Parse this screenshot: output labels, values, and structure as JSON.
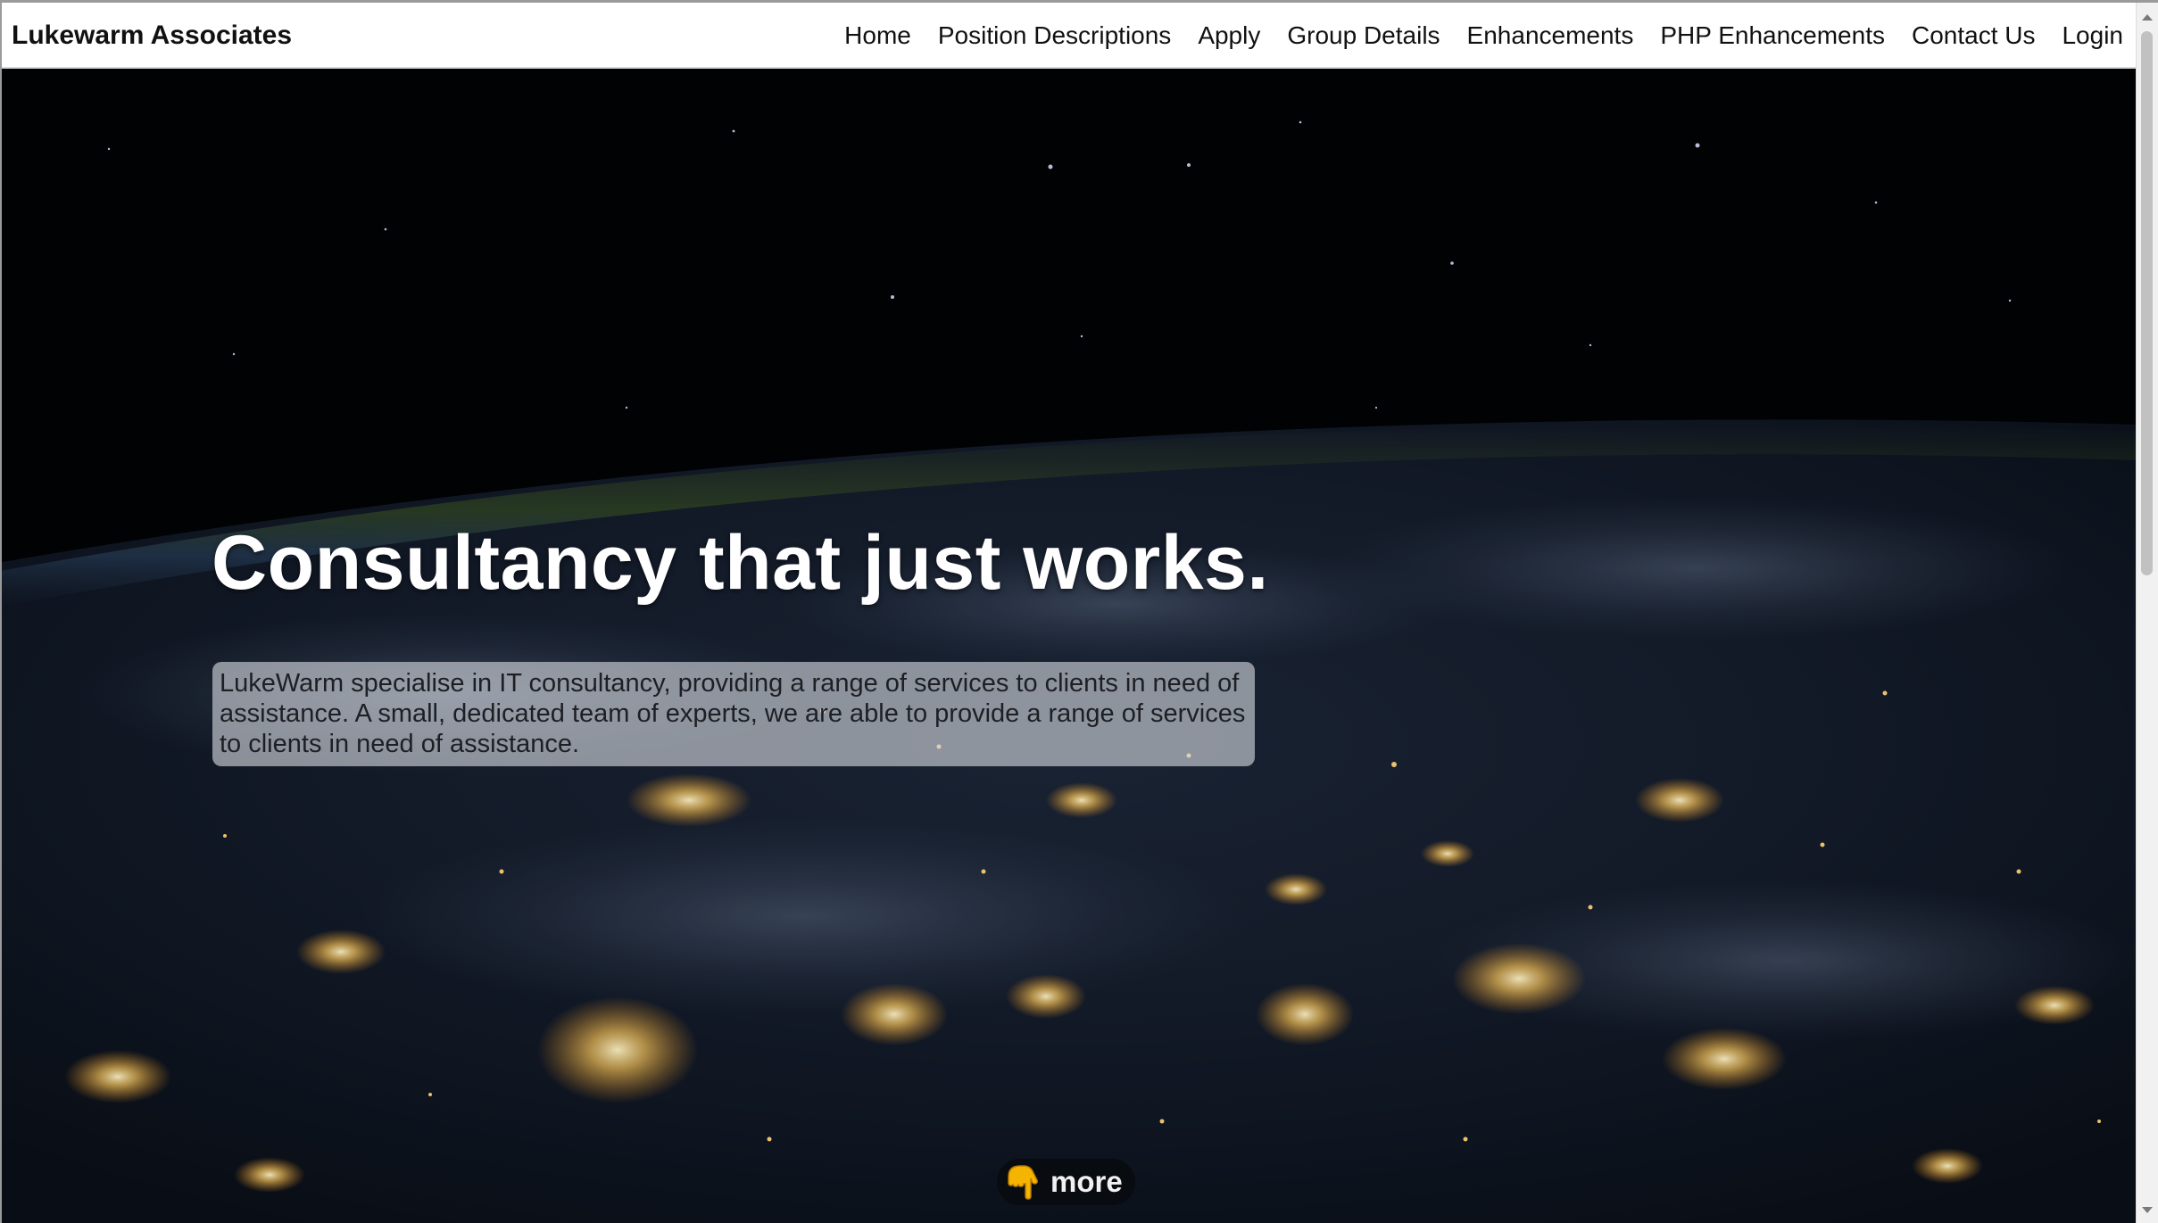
{
  "navbar": {
    "brand": "Lukewarm Associates",
    "links": [
      {
        "label": "Home"
      },
      {
        "label": "Position Descriptions"
      },
      {
        "label": "Apply"
      },
      {
        "label": "Group Details"
      },
      {
        "label": "Enhancements"
      },
      {
        "label": "PHP Enhancements"
      },
      {
        "label": "Contact Us"
      },
      {
        "label": "Login"
      }
    ]
  },
  "hero": {
    "title": "Consultancy that just works.",
    "description": "LukeWarm specialise in IT consultancy, providing a range of services to clients in need of assistance. A small, dedicated team of experts, we are able to provide a range of services to clients in need of assistance.",
    "background": "earth-at-night-from-space",
    "more_button": {
      "icon": "pointing-down-hand-icon",
      "label": "more"
    }
  },
  "colors": {
    "nav_background": "#ffffff",
    "nav_text": "#111111",
    "hero_title": "#ffffff",
    "text_box": "#d7dae1",
    "more_button_bg": "#080a0e",
    "more_icon": "#f4b400"
  }
}
